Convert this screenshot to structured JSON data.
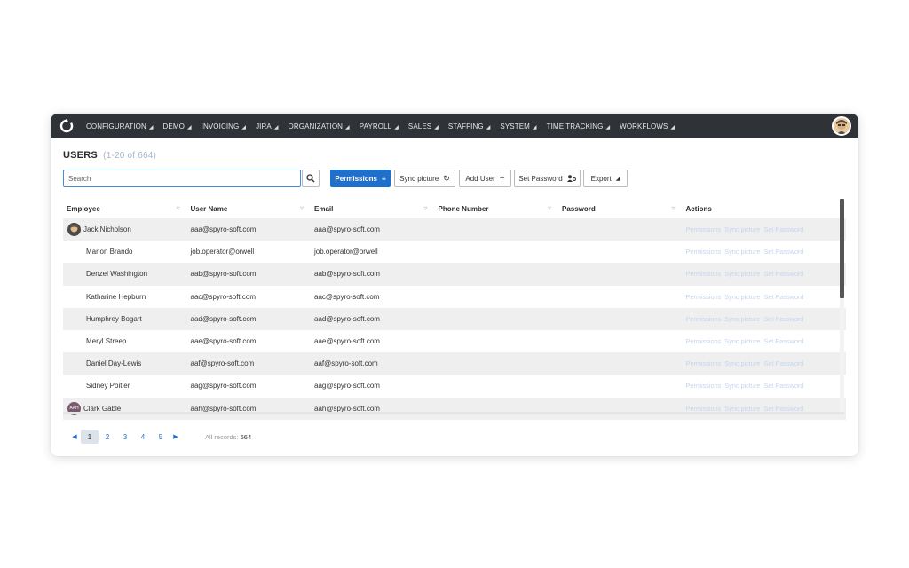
{
  "nav": {
    "menu": [
      {
        "label": "CONFIGURATION"
      },
      {
        "label": "DEMO"
      },
      {
        "label": "INVOICING"
      },
      {
        "label": "JIRA"
      },
      {
        "label": "ORGANIZATION"
      },
      {
        "label": "PAYROLL"
      },
      {
        "label": "SALES"
      },
      {
        "label": "STAFFING"
      },
      {
        "label": "SYSTEM"
      },
      {
        "label": "TIME TRACKING"
      },
      {
        "label": "WORKFLOWS"
      }
    ]
  },
  "page": {
    "title": "USERS",
    "count": "(1-20 of 664)"
  },
  "toolbar": {
    "search_placeholder": "Search",
    "permissions_label": "Permissions",
    "sync_label": "Sync picture",
    "add_user_label": "Add User",
    "set_password_label": "Set Password",
    "export_label": "Export"
  },
  "table": {
    "columns": [
      "Employee",
      "User Name",
      "Email",
      "Phone Number",
      "Password",
      "Actions"
    ],
    "action_links": [
      "Permissions",
      "Sync picture",
      "Set Password"
    ],
    "rows": [
      {
        "employee": "Jack Nicholson",
        "username": "aaa@spyro-soft.com",
        "email": "aaa@spyro-soft.com",
        "avatar": "photo"
      },
      {
        "employee": "Marlon Brando",
        "username": "job.operator@orwell",
        "email": "job.operator@orwell",
        "avatar": ""
      },
      {
        "employee": "Denzel Washington",
        "username": "aab@spyro-soft.com",
        "email": "aab@spyro-soft.com",
        "avatar": ""
      },
      {
        "employee": "Katharine Hepburn",
        "username": "aac@spyro-soft.com",
        "email": "aac@spyro-soft.com",
        "avatar": ""
      },
      {
        "employee": "Humphrey Bogart",
        "username": "aad@spyro-soft.com",
        "email": "aad@spyro-soft.com",
        "avatar": ""
      },
      {
        "employee": "Meryl Streep",
        "username": "aae@spyro-soft.com",
        "email": "aae@spyro-soft.com",
        "avatar": ""
      },
      {
        "employee": "Daniel Day-Lewis",
        "username": "aaf@spyro-soft.com",
        "email": "aaf@spyro-soft.com",
        "avatar": ""
      },
      {
        "employee": "Sidney Poitier",
        "username": "aag@spyro-soft.com",
        "email": "aag@spyro-soft.com",
        "avatar": ""
      },
      {
        "employee": "Clark Gable",
        "username": "aah@spyro-soft.com",
        "email": "aah@spyro-soft.com",
        "avatar": "AAH"
      }
    ]
  },
  "pager": {
    "pages": [
      "1",
      "2",
      "3",
      "4",
      "5"
    ],
    "active_page": "1",
    "records_label": "All records:",
    "records_total": "664"
  },
  "colors": {
    "topbar": "#2f3338",
    "primary": "#1f6fcc",
    "action_link": "#c4d6ee",
    "row_alt": "#efefef"
  }
}
